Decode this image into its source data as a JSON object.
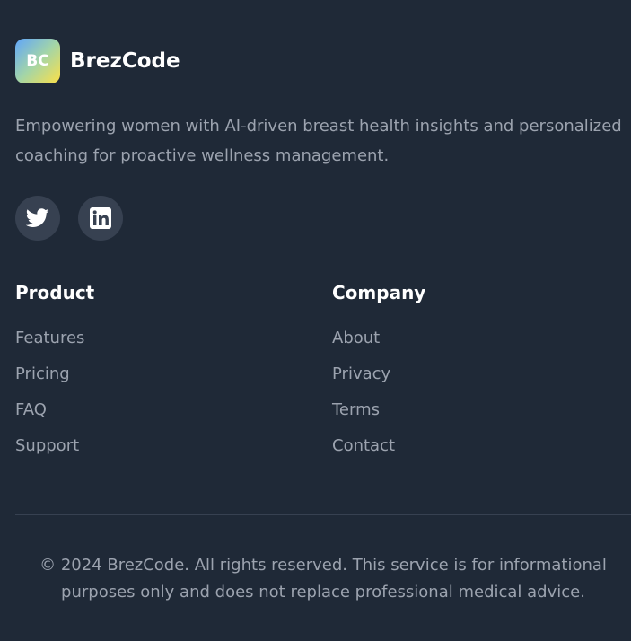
{
  "brand": {
    "logo_text": "BC",
    "name": "BrezCode"
  },
  "tagline": "Empowering women with AI-driven breast health insights and personalized coaching for proactive wellness management.",
  "social": [
    {
      "icon": "twitter-icon"
    },
    {
      "icon": "linkedin-icon"
    }
  ],
  "columns": {
    "product": {
      "title": "Product",
      "links": [
        "Features",
        "Pricing",
        "FAQ",
        "Support"
      ]
    },
    "company": {
      "title": "Company",
      "links": [
        "About",
        "Privacy",
        "Terms",
        "Contact"
      ]
    }
  },
  "copyright": "© 2024 BrezCode. All rights reserved. This service is for informational purposes only and does not replace professional medical advice.",
  "colors": {
    "background": "#1f2937",
    "social_bg": "#374151",
    "text_muted": "#9ca3af",
    "heading": "#ffffff"
  }
}
